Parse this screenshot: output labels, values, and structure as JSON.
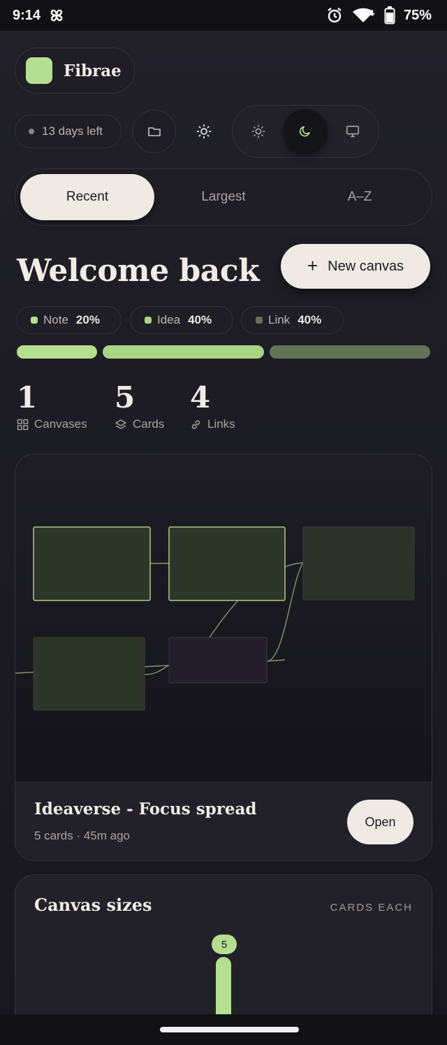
{
  "status_bar": {
    "time": "9:14",
    "battery": "75%",
    "icons": [
      "pinwheel-icon",
      "alarm-icon",
      "wifi-icon",
      "battery-icon"
    ]
  },
  "brand": {
    "name": "Fibrae",
    "accent": "#b5df90"
  },
  "controls": {
    "trial_text": "13 days left",
    "icons": [
      "folder-icon",
      "sun-icon",
      "sun-small-icon",
      "moon-icon",
      "monitor-icon"
    ],
    "active_theme": "dark"
  },
  "tabs": [
    {
      "label": "Recent",
      "active": true
    },
    {
      "label": "Largest",
      "active": false
    },
    {
      "label": "A–Z",
      "active": false
    }
  ],
  "welcome": {
    "title": "Welcome back",
    "new_canvas_label": "New canvas"
  },
  "types": [
    {
      "name": "Note",
      "percent": "20%",
      "share": 20,
      "color": "#b5df90"
    },
    {
      "name": "Idea",
      "percent": "40%",
      "share": 40,
      "color": "#a9d584"
    },
    {
      "name": "Link",
      "percent": "40%",
      "share": 40,
      "color": "#627357"
    }
  ],
  "stats": [
    {
      "value": "1",
      "label": "Canvases",
      "icon": "grid-icon"
    },
    {
      "value": "5",
      "label": "Cards",
      "icon": "layers-icon"
    },
    {
      "value": "4",
      "label": "Links",
      "icon": "link-icon"
    }
  ],
  "canvas": {
    "title": "Ideaverse - Focus spread",
    "meta": "5 cards · 45m ago",
    "open_label": "Open"
  },
  "sizes": {
    "title": "Canvas sizes",
    "tag": "CARDS EACH",
    "bars": [
      {
        "value": "5"
      }
    ]
  }
}
